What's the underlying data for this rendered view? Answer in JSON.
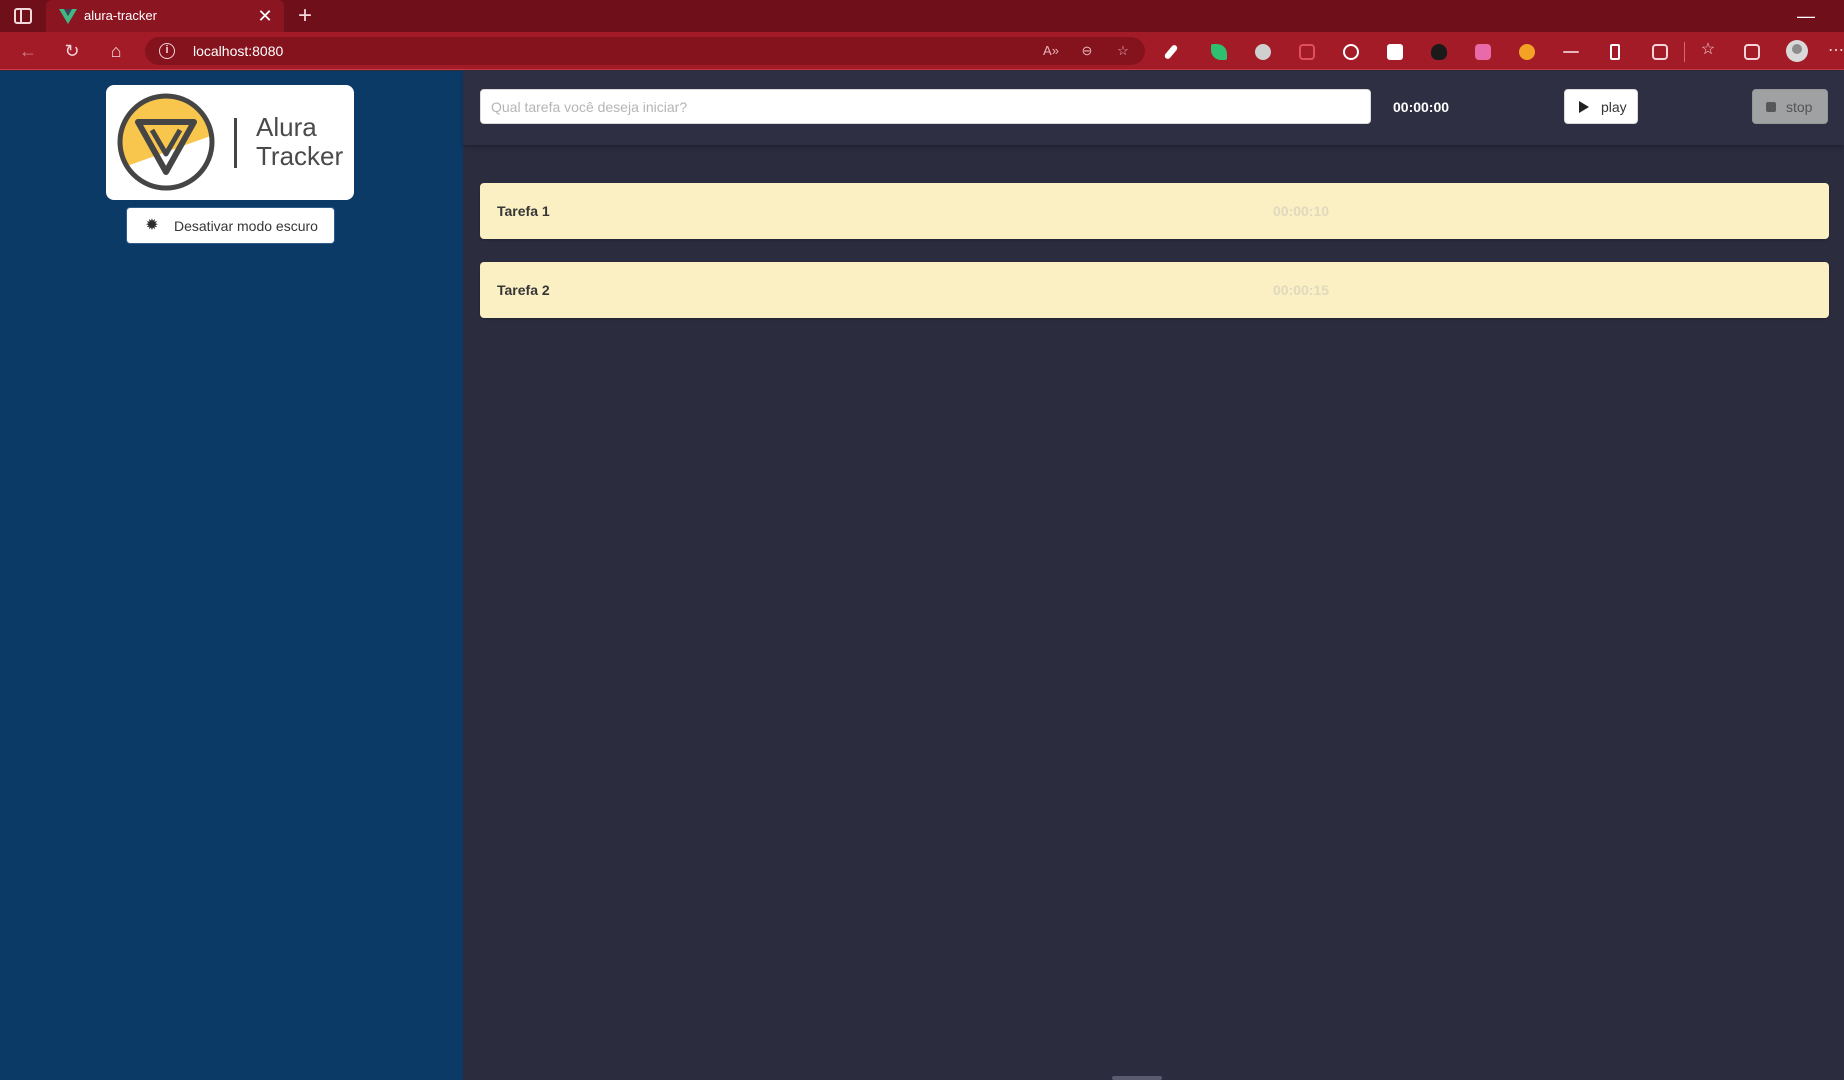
{
  "browser": {
    "tab_title": "alura-tracker",
    "tab_close": "✕",
    "new_tab": "+",
    "minimize": "—",
    "url": "localhost:8080",
    "nav": {
      "back": "←",
      "reload": "↻",
      "home": "⌂"
    }
  },
  "extension_icons": [
    "read-aloud-icon",
    "zoom-out-icon",
    "favorite-add-icon",
    "pen-icon",
    "leaf-icon",
    "sphere-icon",
    "screenshot-icon",
    "react-icon",
    "notion-icon",
    "flame-icon",
    "m-icon",
    "firefox-icon",
    "strike-icon",
    "phone-icon",
    "extensions-icon",
    "favorites-icon",
    "collections-icon"
  ],
  "sidebar": {
    "logo_text_line1": "Alura",
    "logo_text_line2": "Tracker",
    "dark_mode_button": "Desativar modo escuro"
  },
  "form": {
    "placeholder": "Qual tarefa você deseja iniciar?",
    "timer": "00:00:00",
    "play_label": "play",
    "stop_label": "stop"
  },
  "tasks": [
    {
      "name": "Tarefa 1",
      "time": "00:00:10"
    },
    {
      "name": "Tarefa 2",
      "time": "00:00:15"
    }
  ],
  "colors": {
    "tabbar": "#6e0f19",
    "addrbar": "#a31b27",
    "sidebar": "#0c3a66",
    "content": "#2b2c3e",
    "task_bg": "#faf0c4",
    "logo_accent": "#f8c64d"
  }
}
